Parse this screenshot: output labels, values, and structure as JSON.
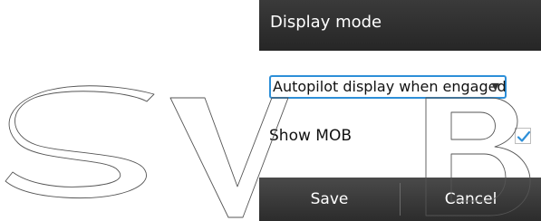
{
  "dialog": {
    "title": "Display mode",
    "dropdown": {
      "selected": "Autopilot display when engaged"
    },
    "show_mob": {
      "label": "Show MOB",
      "checked": true
    },
    "buttons": {
      "save": "Save",
      "cancel": "Cancel"
    }
  },
  "watermark": {
    "text": "SVB"
  },
  "colors": {
    "accent": "#2d8fd8",
    "titlebar": "#2f2f2f",
    "buttonbar": "#3a3a3a"
  },
  "icons": {
    "dropdown_caret": "caret-down-icon",
    "checkmark": "checkmark-icon"
  }
}
